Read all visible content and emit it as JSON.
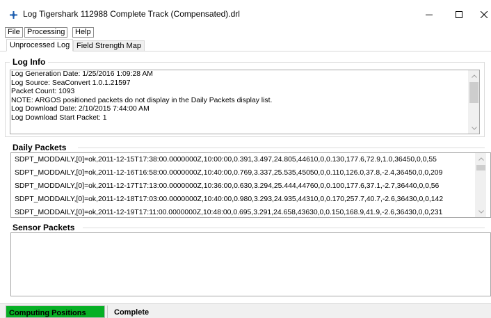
{
  "window": {
    "title": "Log Tigershark 112988 Complete Track (Compensated).drl",
    "icon": "crosshair-icon",
    "controls": {
      "minimize": "minimize-icon",
      "maximize": "maximize-icon",
      "close": "close-icon"
    }
  },
  "menu": {
    "items": [
      {
        "label": "File"
      },
      {
        "label": "Processing"
      },
      {
        "label": "Help"
      }
    ]
  },
  "tabs": [
    {
      "label": "Unprocessed Log",
      "active": true
    },
    {
      "label": "Field Strength Map",
      "active": false
    }
  ],
  "log_info": {
    "title": "Log Info",
    "lines": [
      "Log Generation Date: 1/25/2016 1:09:28 AM",
      "Log Source: SeaConvert 1.0.1.21597",
      "Packet Count: 1093",
      "NOTE: ARGOS positioned packets do not display in the Daily Packets display list.",
      "Log Download Date: 2/10/2015 7:44:00 AM",
      "Log Download Start Packet: 1"
    ]
  },
  "daily_packets": {
    "title": "Daily Packets",
    "rows": [
      "SDPT_MODDAILY,[0]=ok,2011-12-15T17:38:00.0000000Z,10:00:00,0.391,3.497,24.805,44610,0,0.130,177.6,72.9,1.0,36450,0,0,55",
      "SDPT_MODDAILY,[0]=ok,2011-12-16T16:58:00.0000000Z,10:40:00,0.769,3.337,25.535,45050,0,0.110,126.0,37.8,-2.4,36450,0,0,209",
      "SDPT_MODDAILY,[0]=ok,2011-12-17T17:13:00.0000000Z,10:36:00,0.630,3.294,25.444,44760,0,0.100,177.6,37.1,-2.7,36440,0,0,56",
      "SDPT_MODDAILY,[0]=ok,2011-12-18T17:03:00.0000000Z,10:40:00,0.980,3.293,24.935,44310,0,0.170,257.7,40.7,-2.6,36430,0,0,142",
      "SDPT_MODDAILY,[0]=ok,2011-12-19T17:11:00.0000000Z,10:48:00,0.695,3.291,24.658,43630,0,0.150,168.9,41.9,-2.6,36430,0,0,231"
    ]
  },
  "sensor_packets": {
    "title": "Sensor Packets",
    "rows": []
  },
  "status": {
    "progress_label": "Computing Positions",
    "progress_fraction": 1.0,
    "progress_color": "#06b025",
    "message": "Complete"
  }
}
